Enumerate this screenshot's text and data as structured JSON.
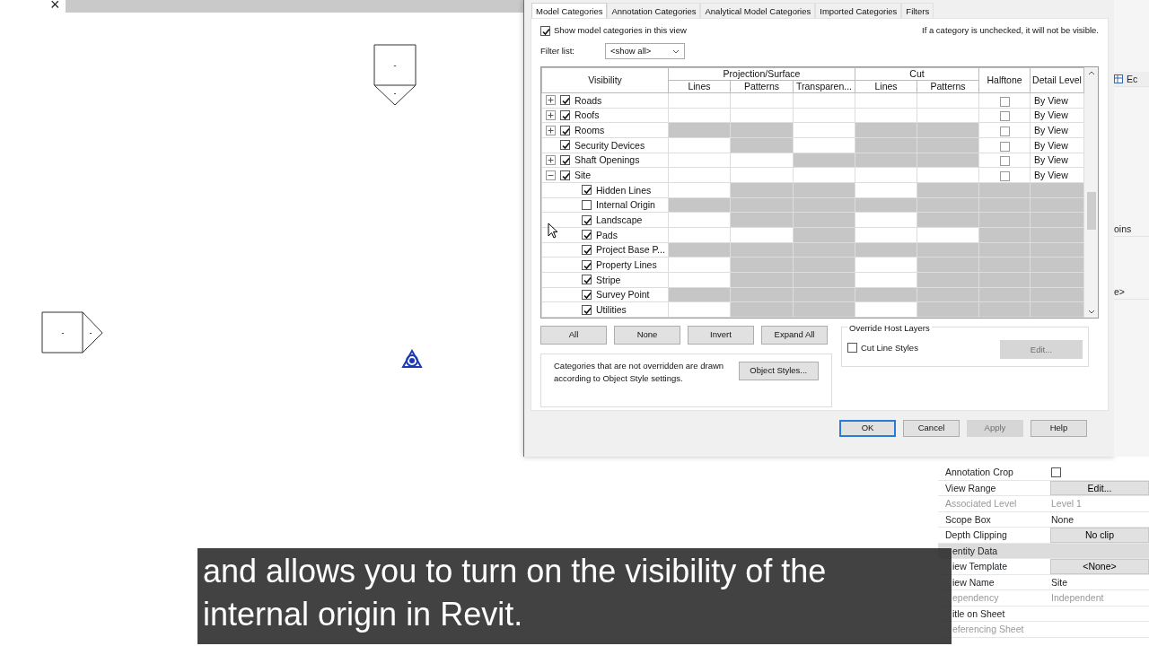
{
  "canvas": {
    "close_glyph": "×",
    "markers": [
      {
        "kind": "down",
        "labels": [
          "-",
          "-"
        ]
      },
      {
        "kind": "right",
        "labels": [
          "-",
          "-"
        ]
      }
    ]
  },
  "dialog": {
    "tabs": [
      {
        "label": "Model Categories",
        "selected": true
      },
      {
        "label": "Annotation Categories",
        "selected": false
      },
      {
        "label": "Analytical Model Categories",
        "selected": false
      },
      {
        "label": "Imported Categories",
        "selected": false
      },
      {
        "label": "Filters",
        "selected": false
      }
    ],
    "show_categories": {
      "label": "Show model categories in this view",
      "checked": true
    },
    "note": "If a category is unchecked, it will not be visible.",
    "filter": {
      "label": "Filter list:",
      "value": "<show all>"
    },
    "table": {
      "visibility": "Visibility",
      "groups": [
        {
          "label": "Projection/Surface",
          "columns": [
            "Lines",
            "Patterns",
            "Transparen..."
          ]
        },
        {
          "label": "Cut",
          "columns": [
            "Lines",
            "Patterns"
          ]
        }
      ],
      "halftone": "Halftone",
      "detail": "Detail Level",
      "rows": [
        {
          "name": "Roads",
          "checked": true,
          "expanded": false,
          "shaded": [
            false,
            false,
            false,
            false,
            false
          ],
          "halftone": false,
          "detail_level": "By View"
        },
        {
          "name": "Roofs",
          "checked": true,
          "expanded": false,
          "shaded": [
            false,
            false,
            false,
            false,
            false
          ],
          "halftone": false,
          "detail_level": "By View"
        },
        {
          "name": "Rooms",
          "checked": true,
          "expanded": false,
          "shaded": [
            true,
            true,
            false,
            true,
            true
          ],
          "halftone": false,
          "detail_level": "By View"
        },
        {
          "name": "Security Devices",
          "checked": true,
          "shaded": [
            false,
            true,
            false,
            true,
            true
          ],
          "halftone": false,
          "detail_level": "By View"
        },
        {
          "name": "Shaft Openings",
          "checked": true,
          "expanded": false,
          "shaded": [
            false,
            false,
            true,
            true,
            true
          ],
          "halftone": false,
          "detail_level": "By View"
        },
        {
          "name": "Site",
          "checked": true,
          "expanded": true,
          "shaded": [
            false,
            false,
            false,
            false,
            false
          ],
          "halftone": false,
          "detail_level": "By View",
          "children": [
            {
              "name": "Hidden Lines",
              "checked": true,
              "shaded": [
                false,
                true,
                true,
                false,
                true,
                true,
                true
              ]
            },
            {
              "name": "Internal Origin",
              "checked": false,
              "shaded": [
                true,
                true,
                true,
                true,
                true,
                true,
                true
              ]
            },
            {
              "name": "Landscape",
              "checked": true,
              "shaded": [
                false,
                true,
                true,
                false,
                true,
                true,
                true
              ]
            },
            {
              "name": "Pads",
              "checked": true,
              "shaded": [
                false,
                false,
                true,
                false,
                false,
                true,
                true
              ]
            },
            {
              "name": "Project Base P...",
              "checked": true,
              "shaded": [
                true,
                true,
                true,
                true,
                true,
                true,
                true
              ]
            },
            {
              "name": "Property Lines",
              "checked": true,
              "shaded": [
                false,
                true,
                true,
                false,
                true,
                true,
                true
              ]
            },
            {
              "name": "Stripe",
              "checked": true,
              "shaded": [
                false,
                true,
                true,
                false,
                true,
                true,
                true
              ]
            },
            {
              "name": "Survey Point",
              "checked": true,
              "shaded": [
                true,
                true,
                true,
                true,
                true,
                true,
                true
              ]
            },
            {
              "name": "Utilities",
              "checked": true,
              "shaded": [
                false,
                true,
                true,
                false,
                true,
                true,
                true
              ]
            }
          ]
        }
      ]
    },
    "row_buttons": [
      "All",
      "None",
      "Invert",
      "Expand All"
    ],
    "info": {
      "text": "Categories that are not overridden are drawn according to Object Style settings.",
      "button": "Object Styles..."
    },
    "override": {
      "title": "Override Host Layers",
      "checkbox": {
        "label": "Cut Line Styles",
        "checked": false
      },
      "button": {
        "label": "Edit...",
        "disabled": true
      }
    },
    "footer": [
      {
        "label": "OK",
        "default": true,
        "disabled": false
      },
      {
        "label": "Cancel",
        "default": false,
        "disabled": false
      },
      {
        "label": "Apply",
        "default": false,
        "disabled": true
      },
      {
        "label": "Help",
        "default": false,
        "disabled": false
      }
    ]
  },
  "properties": {
    "fragments": [
      {
        "kind": "edit-button",
        "text": "Ec"
      },
      {
        "kind": "cell",
        "text": "oins"
      },
      {
        "kind": "cell",
        "text": "e>"
      }
    ],
    "rows": [
      {
        "kind": "checkbox",
        "label": "Annotation Crop",
        "checked": false,
        "disabled": false
      },
      {
        "kind": "button",
        "label": "View Range",
        "value": "Edit...",
        "disabled": false
      },
      {
        "kind": "text",
        "label": "Associated Level",
        "value": "Level 1",
        "disabled": true
      },
      {
        "kind": "text",
        "label": "Scope Box",
        "value": "None",
        "disabled": false
      },
      {
        "kind": "button",
        "label": "Depth Clipping",
        "value": "No clip",
        "disabled": false
      },
      {
        "kind": "section",
        "label": "entity Data"
      },
      {
        "kind": "button",
        "label": "iew Template",
        "value": "<None>",
        "disabled": false
      },
      {
        "kind": "text",
        "label": "iew Name",
        "value": "Site",
        "disabled": false
      },
      {
        "kind": "text",
        "label": "ependency",
        "value": "Independent",
        "disabled": true
      },
      {
        "kind": "empty",
        "label": "itle on Sheet",
        "disabled": false
      },
      {
        "kind": "empty",
        "label": "eferencing Sheet",
        "disabled": true
      }
    ]
  },
  "subtitle": [
    "and allows you to turn on the visibility of the",
    "internal origin in Revit."
  ]
}
